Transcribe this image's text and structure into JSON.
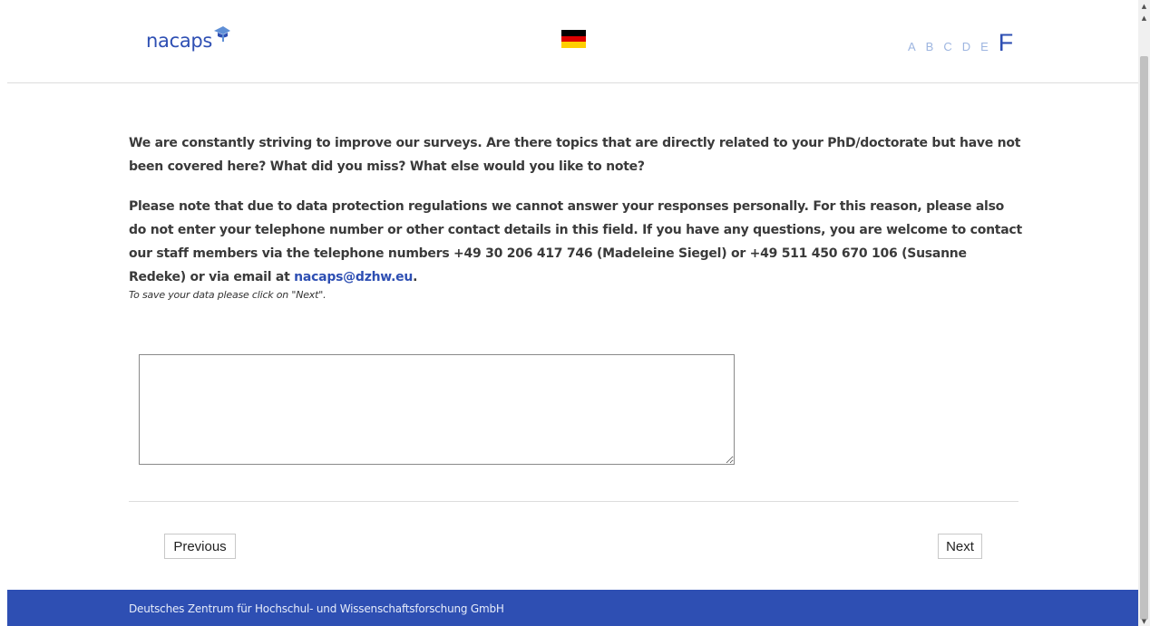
{
  "header": {
    "logo_text": "nacaps",
    "flag_label": "German flag",
    "font_sizes": [
      "A",
      "B",
      "C",
      "D",
      "E",
      "F"
    ],
    "active_font_size": "F"
  },
  "main": {
    "question_paragraph_1": "We are constantly striving to improve our surveys. Are there topics that are directly related to your PhD/doctorate but have not been covered here? What did you miss? What else would you like to note?",
    "question_paragraph_2_prefix": "Please note that due to data protection regulations we cannot answer your responses personally. For this reason, please also do not enter your telephone number or other contact details in this field. If you have any questions, you are welcome to contact our staff members via the telephone numbers +49 30 206 417 746 (Madeleine Siegel) or +49 511 450 670 106 (Susanne Redeke) or via email at ",
    "email_link": "nacaps@dzhw.eu",
    "question_paragraph_2_suffix": ".",
    "hint": "To save your data please click on \"Next\".",
    "textarea_value": ""
  },
  "nav": {
    "previous_label": "Previous",
    "next_label": "Next"
  },
  "footer": {
    "text": "Deutsches Zentrum für Hochschul- und Wissenschaftsforschung GmbH"
  },
  "colors": {
    "brand_blue": "#2e4fb3",
    "font_size_inactive": "#9db5e0"
  }
}
